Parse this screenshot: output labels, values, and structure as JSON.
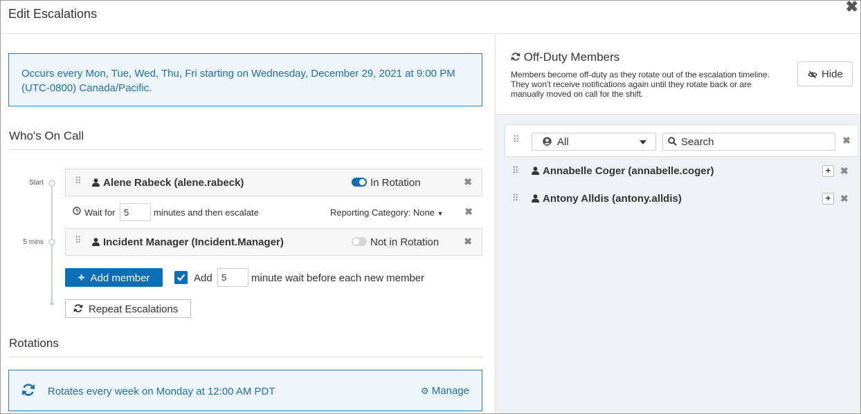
{
  "header": {
    "title": "Edit Escalations"
  },
  "schedule": {
    "occurs_text": "Occurs every Mon, Tue, Wed, Thu, Fri starting on Wednesday, December 29, 2021 at 9:00 PM (UTC-0800) Canada/Pacific."
  },
  "on_call": {
    "title": "Who's On Call",
    "timeline_labels": [
      "Start",
      "5 mins"
    ],
    "members": [
      {
        "name": "Alene Rabeck (alene.rabeck)",
        "rotation_status": "In Rotation",
        "in_rotation": true
      },
      {
        "name": "Incident Manager (Incident.Manager)",
        "rotation_status": "Not in Rotation",
        "in_rotation": false
      }
    ],
    "wait": {
      "prefix": "Wait for",
      "value": "5",
      "suffix": "minutes and then escalate",
      "reporting_category": "Reporting Category: None"
    },
    "add_member_label": "Add member",
    "add_wait": {
      "checked": true,
      "label": "Add",
      "value": "5",
      "suffix": "minute wait before each new member"
    },
    "repeat_label": "Repeat Escalations"
  },
  "rotations": {
    "title": "Rotations",
    "text": "Rotates every week on Monday at 12:00 AM PDT",
    "manage_label": "Manage"
  },
  "off_duty": {
    "title": "Off-Duty Members",
    "description": "Members become off-duty as they rotate out of the escalation timeline. They won't receive notifications again until they rotate back or are manually moved on call for the shift.",
    "hide_label": "Hide",
    "filter": {
      "selected": "All",
      "search_placeholder": "Search"
    },
    "members": [
      {
        "name": "Annabelle Coger (annabelle.coger)"
      },
      {
        "name": "Antony Alldis (antony.alldis)"
      }
    ]
  },
  "colors": {
    "accent": "#0b6fb8",
    "link": "#1f6fae",
    "info_bg": "#eef5fa",
    "panel_bg": "#edf1f4"
  }
}
